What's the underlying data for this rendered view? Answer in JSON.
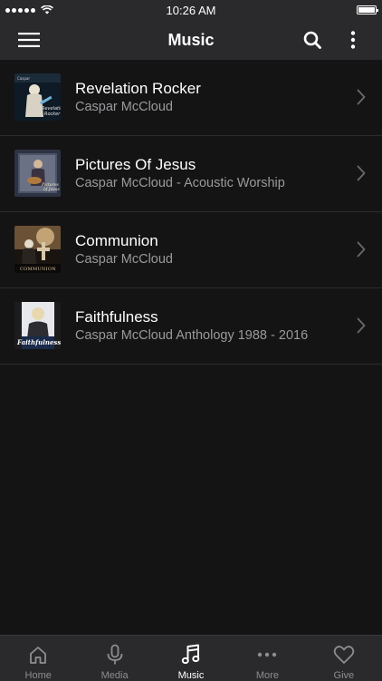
{
  "status_bar": {
    "time": "10:26 AM"
  },
  "header": {
    "title": "Music"
  },
  "albums": [
    {
      "title": "Revelation Rocker",
      "artist": "Caspar McCloud",
      "art_label": "Revelation Rocker"
    },
    {
      "title": "Pictures Of Jesus",
      "artist": "Caspar McCloud - Acoustic Worship",
      "art_label": "Pictures of Jesus"
    },
    {
      "title": "Communion",
      "artist": "Caspar McCloud",
      "art_label": "COMMUNION"
    },
    {
      "title": "Faithfulness",
      "artist": "Caspar McCloud Anthology 1988 - 2016",
      "art_label": "Faithfulness"
    }
  ],
  "tabs": [
    {
      "label": "Home",
      "icon": "home-icon",
      "active": false
    },
    {
      "label": "Media",
      "icon": "microphone-icon",
      "active": false
    },
    {
      "label": "Music",
      "icon": "music-note-icon",
      "active": true
    },
    {
      "label": "More",
      "icon": "ellipsis-icon",
      "active": false
    },
    {
      "label": "Give",
      "icon": "heart-icon",
      "active": false
    }
  ],
  "colors": {
    "background": "#141415",
    "bar": "#2a2a2c",
    "subtitle": "#9a9a9c",
    "tab_inactive": "#8e8e90"
  }
}
